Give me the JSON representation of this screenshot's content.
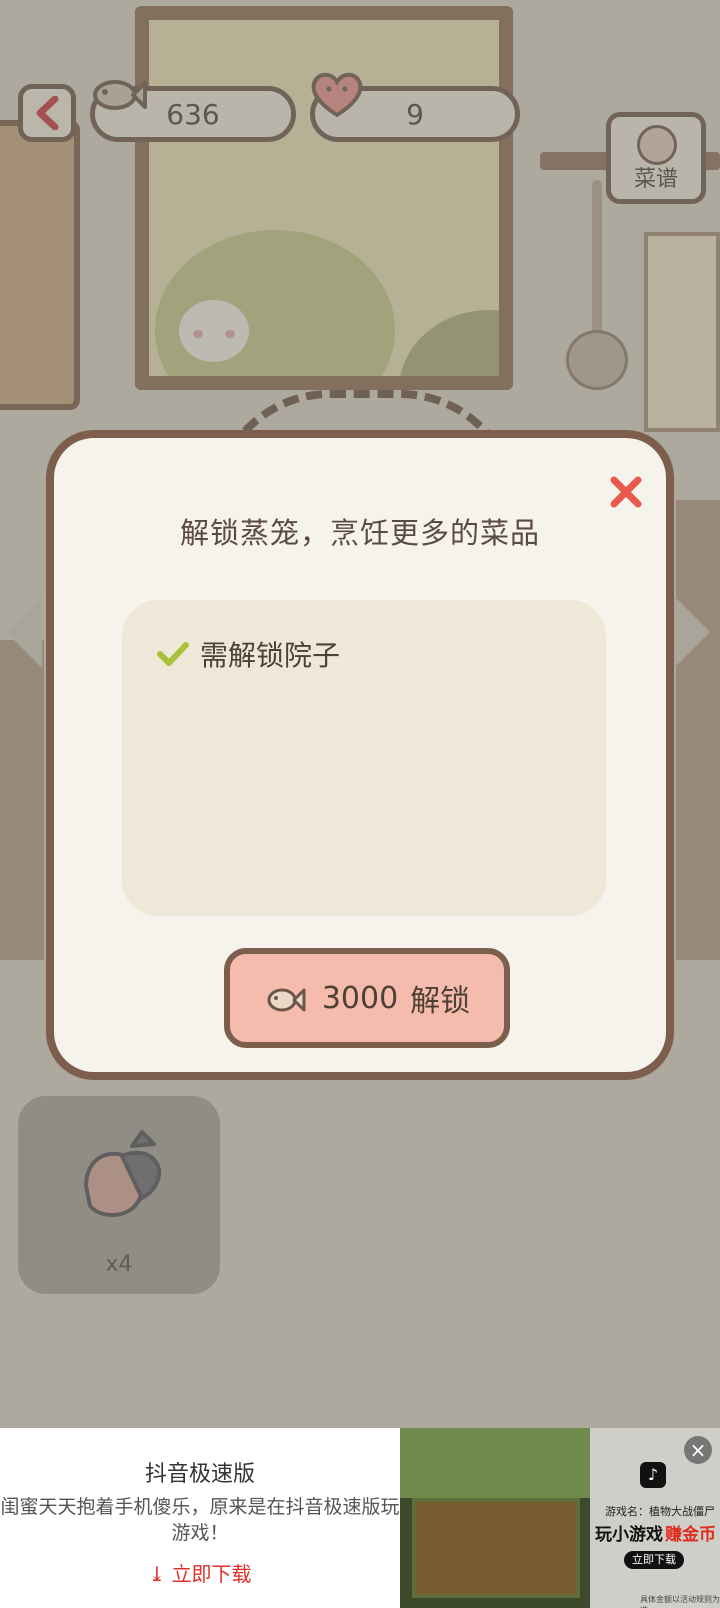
{
  "header": {
    "back_icon": "chevron-left-icon",
    "fish_count": "636",
    "heart_count": "9",
    "recipe_label": "菜谱"
  },
  "inventory": {
    "item_icon": "fish-icon",
    "count": "x4"
  },
  "modal": {
    "title": "解锁蒸笼，烹饪更多的菜品",
    "requirement": "需解锁院子",
    "unlock_price": "3000",
    "unlock_label": "解锁",
    "colors": {
      "close": "#e8594c",
      "check": "#a8c23a",
      "button": "#f5bcae"
    }
  },
  "ad": {
    "app_name": "抖音极速版",
    "description": "闺蜜天天抱着手机傻乐，原来是在抖音极速版玩游戏！",
    "download_label": "立即下载",
    "game_name": "游戏名：植物大战僵尸",
    "slogan_1": "玩小游戏",
    "slogan_2": "赚金币",
    "play_label": "立即下载",
    "fine_print": "具体金额以活动规则为准"
  }
}
